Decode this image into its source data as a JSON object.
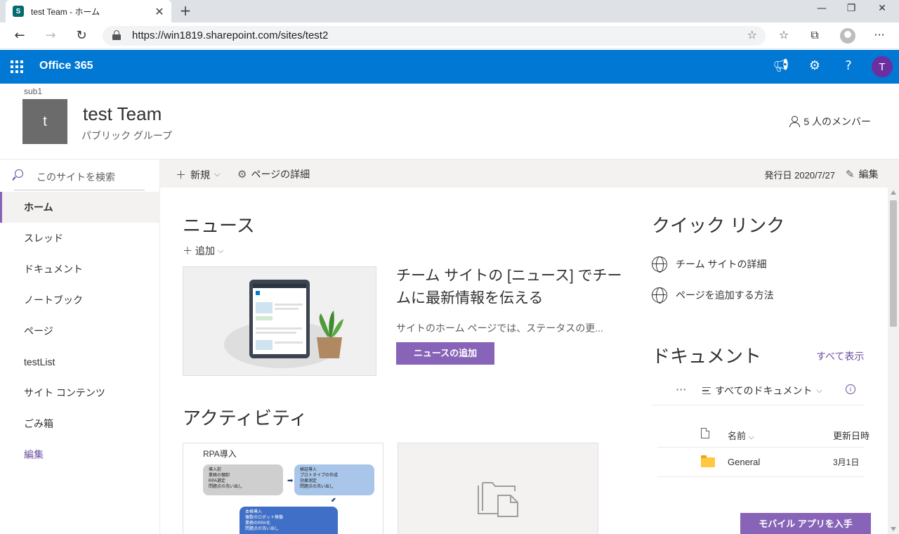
{
  "browser": {
    "tab_title": "test Team - ホーム",
    "tab_favicon": "S",
    "url": "https://win1819.sharepoint.com/sites/test2",
    "icons": {
      "close": "close-icon",
      "new_tab": "plus-icon",
      "back": "back-arrow-icon",
      "forward": "forward-arrow-icon",
      "refresh": "refresh-icon",
      "favorite": "star-icon",
      "favorites": "favorites-list-icon",
      "collections": "collections-icon",
      "more": "more-icon"
    }
  },
  "suitebar": {
    "app_name": "Office 365",
    "avatar_initial": "T",
    "color": "#0078d4"
  },
  "site": {
    "hub_name": "sub1",
    "logo_initial": "t",
    "title": "test Team",
    "subtitle": "パブリック グループ",
    "members": "5 人のメンバー"
  },
  "leftnav": {
    "search_placeholder": "このサイトを検索",
    "items": [
      {
        "label": "ホーム",
        "active": true
      },
      {
        "label": "スレッド"
      },
      {
        "label": "ドキュメント"
      },
      {
        "label": "ノートブック"
      },
      {
        "label": "ページ"
      },
      {
        "label": "testList"
      },
      {
        "label": "サイト コンテンツ"
      },
      {
        "label": "ごみ箱"
      }
    ],
    "edit_label": "編集"
  },
  "cmdbar": {
    "new_label": "新規",
    "details_label": "ページの詳細",
    "published": "発行日 2020/7/27",
    "edit_label": "編集"
  },
  "news": {
    "title": "ニュース",
    "add_label": "追加",
    "headline": "チーム サイトの [ニュース] でチームに最新情報を伝える",
    "description": "サイトのホーム ページでは、ステータスの更...",
    "button": "ニュースの追加"
  },
  "activity": {
    "title": "アクティビティ",
    "card1_title": "RPA導入",
    "ppt": {
      "box1_title": "導入前",
      "box1_lines": [
        "業務の棚卸",
        "RPA選定",
        "問題点の洗い出し"
      ],
      "box2_title": "検証導入",
      "box2_lines": [
        "プロトタイプの作成",
        "効果測定",
        "問題点の洗い出し"
      ],
      "box3_title": "本格導入",
      "box3_lines": [
        "複数のロボット稼働",
        "業務のRPA化",
        "問題点の洗い出し"
      ]
    }
  },
  "quicklinks": {
    "title": "クイック リンク",
    "items": [
      "チーム サイトの詳細",
      "ページを追加する方法"
    ]
  },
  "documents": {
    "title": "ドキュメント",
    "see_all": "すべて表示",
    "view": "すべてのドキュメント",
    "col_name": "名前",
    "col_modified": "更新日時",
    "rows": [
      {
        "name": "General",
        "modified": "3月1日"
      }
    ]
  },
  "mobile_button": "モバイル アプリを入手",
  "colors": {
    "accent": "#8764b8",
    "suite": "#0078d4"
  }
}
